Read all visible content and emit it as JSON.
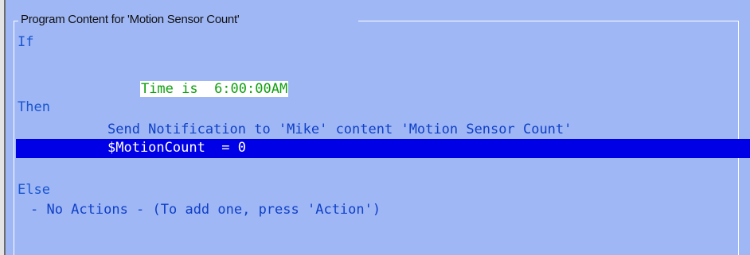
{
  "groupbox": {
    "title": "Program Content for 'Motion Sensor Count'"
  },
  "program": {
    "if_label": "If",
    "condition": "Time is  6:00:00AM",
    "then_label": "Then",
    "then_actions": [
      "Send Notification to 'Mike' content 'Motion Sensor Count'",
      "$MotionCount  = 0"
    ],
    "else_label": "Else",
    "else_placeholder": "- No Actions - (To add one, press 'Action')"
  },
  "colors": {
    "background": "#9fb7f5",
    "keyword": "#1a56d0",
    "condition": "#11a011",
    "selection": "#0000e6"
  }
}
